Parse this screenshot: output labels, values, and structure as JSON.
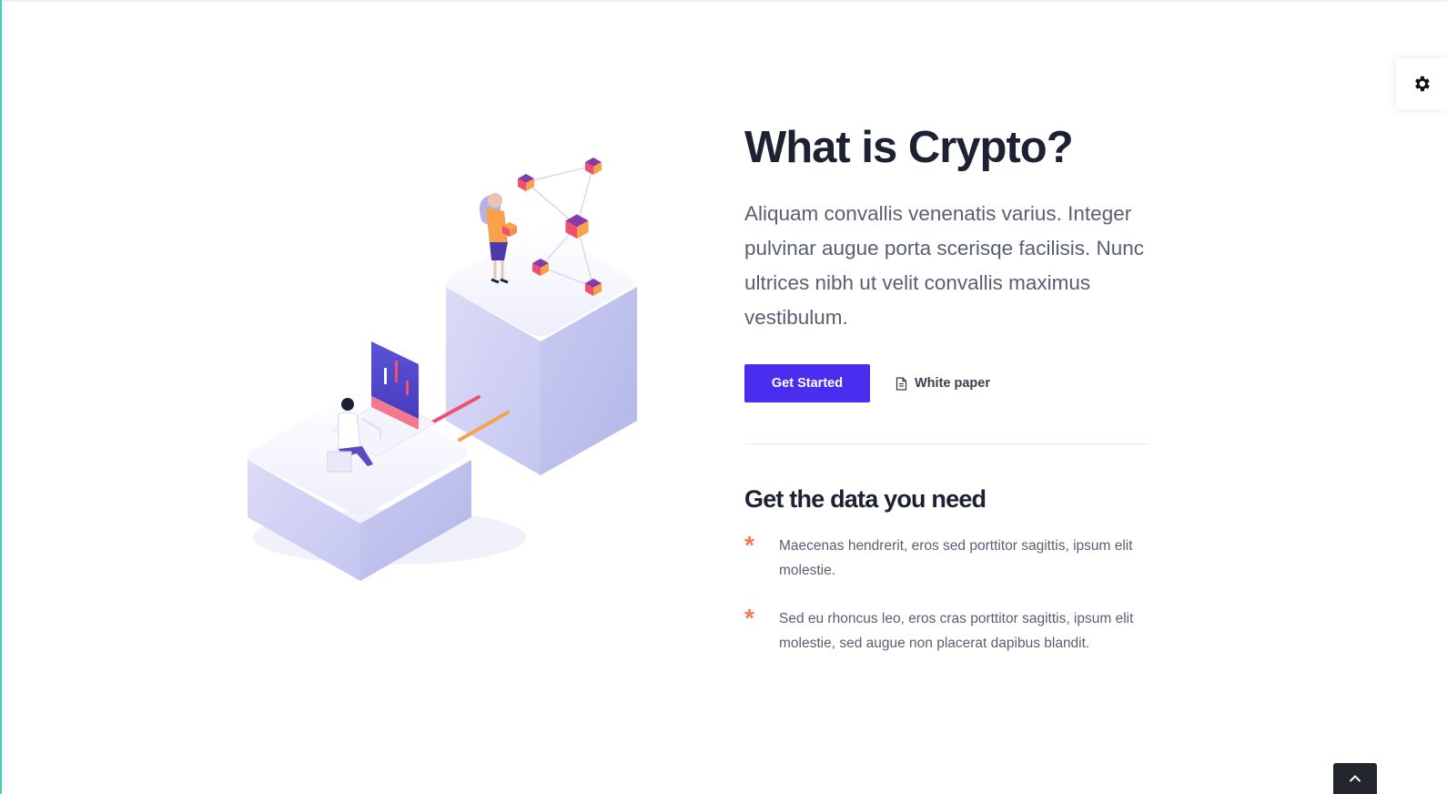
{
  "hero": {
    "title": "What is Crypto?",
    "intro": "Aliquam convallis venenatis varius. Integer pulvinar augue porta scerisqe facilisis. Nunc ultrices nibh ut velit convallis maximus vestibulum.",
    "primary_button": "Get Started",
    "secondary_link": "White paper"
  },
  "features": {
    "title": "Get the data you need",
    "bullet": "*",
    "items": [
      {
        "text": "Maecenas hendrerit, eros sed porttitor sagittis, ipsum elit molestie."
      },
      {
        "text": "Sed eu rhoncus leo, eros cras porttitor sagittis, ipsum elit molestie, sed augue non placerat dapibus blandit."
      }
    ]
  },
  "icons": {
    "settings": "gear-icon",
    "back_to_top": "chevron-up-icon",
    "white_paper": "document-icon"
  },
  "colors": {
    "accent": "#4a2ef0",
    "bullet": "#f47b5b",
    "heading": "#1d2233",
    "body_text": "#5a5e72",
    "edge": "#3fd0c1"
  }
}
